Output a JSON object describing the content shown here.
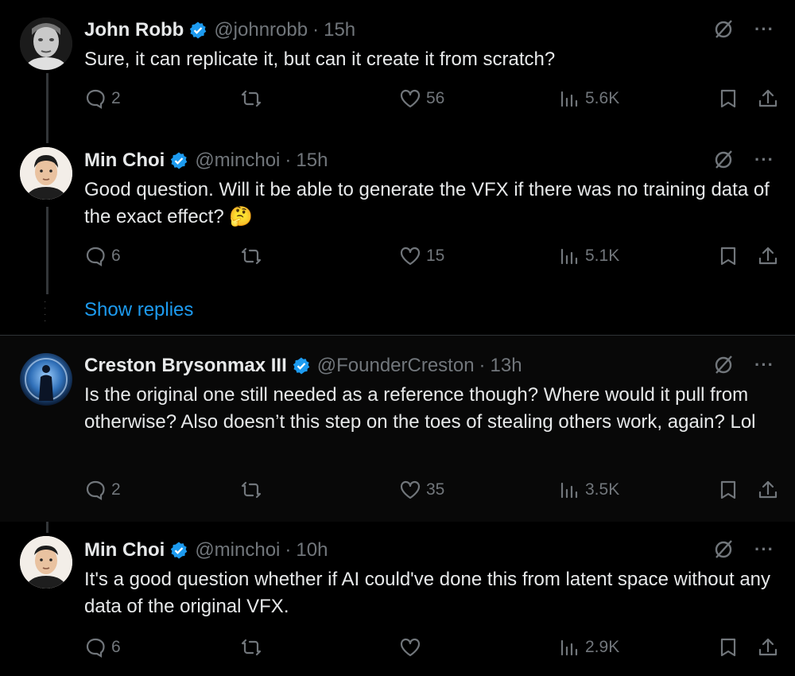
{
  "tweets": [
    {
      "name": "John Robb",
      "handle": "@johnrobb",
      "separator": "·",
      "time": "15h",
      "text": "Sure, it can replicate it, but can it create it from scratch?",
      "replies": "2",
      "retweets": "",
      "likes": "56",
      "views": "5.6K"
    },
    {
      "name": "Min Choi",
      "handle": "@minchoi",
      "separator": "·",
      "time": "15h",
      "text": "Good question.  Will it be able to generate the VFX if there was no training data of the exact effect? 🤔",
      "replies": "6",
      "retweets": "",
      "likes": "15",
      "views": "5.1K"
    },
    {
      "name": "Creston Brysonmax III",
      "handle": "@FounderCreston",
      "separator": "·",
      "time": "13h",
      "text": "Is the original one still needed as a reference though? Where would it pull from otherwise? Also doesn’t this step on the toes of stealing others work, again? Lol",
      "replies": "2",
      "retweets": "",
      "likes": "35",
      "views": "3.5K"
    },
    {
      "name": "Min Choi",
      "handle": "@minchoi",
      "separator": "·",
      "time": "10h",
      "text": "It's a good question whether if AI could've done this from latent space without any data of the original VFX.",
      "replies": "6",
      "retweets": "",
      "likes": "",
      "views": "2.9K"
    }
  ],
  "show_replies": "Show replies",
  "more_label": "···",
  "colors": {
    "accent": "#1d9bf0",
    "muted": "#71767b",
    "text": "#e7e9ea"
  },
  "icons": [
    "verified-badge-icon",
    "grok-icon",
    "more-icon",
    "reply-icon",
    "retweet-icon",
    "like-icon",
    "views-icon",
    "bookmark-icon",
    "share-icon"
  ]
}
